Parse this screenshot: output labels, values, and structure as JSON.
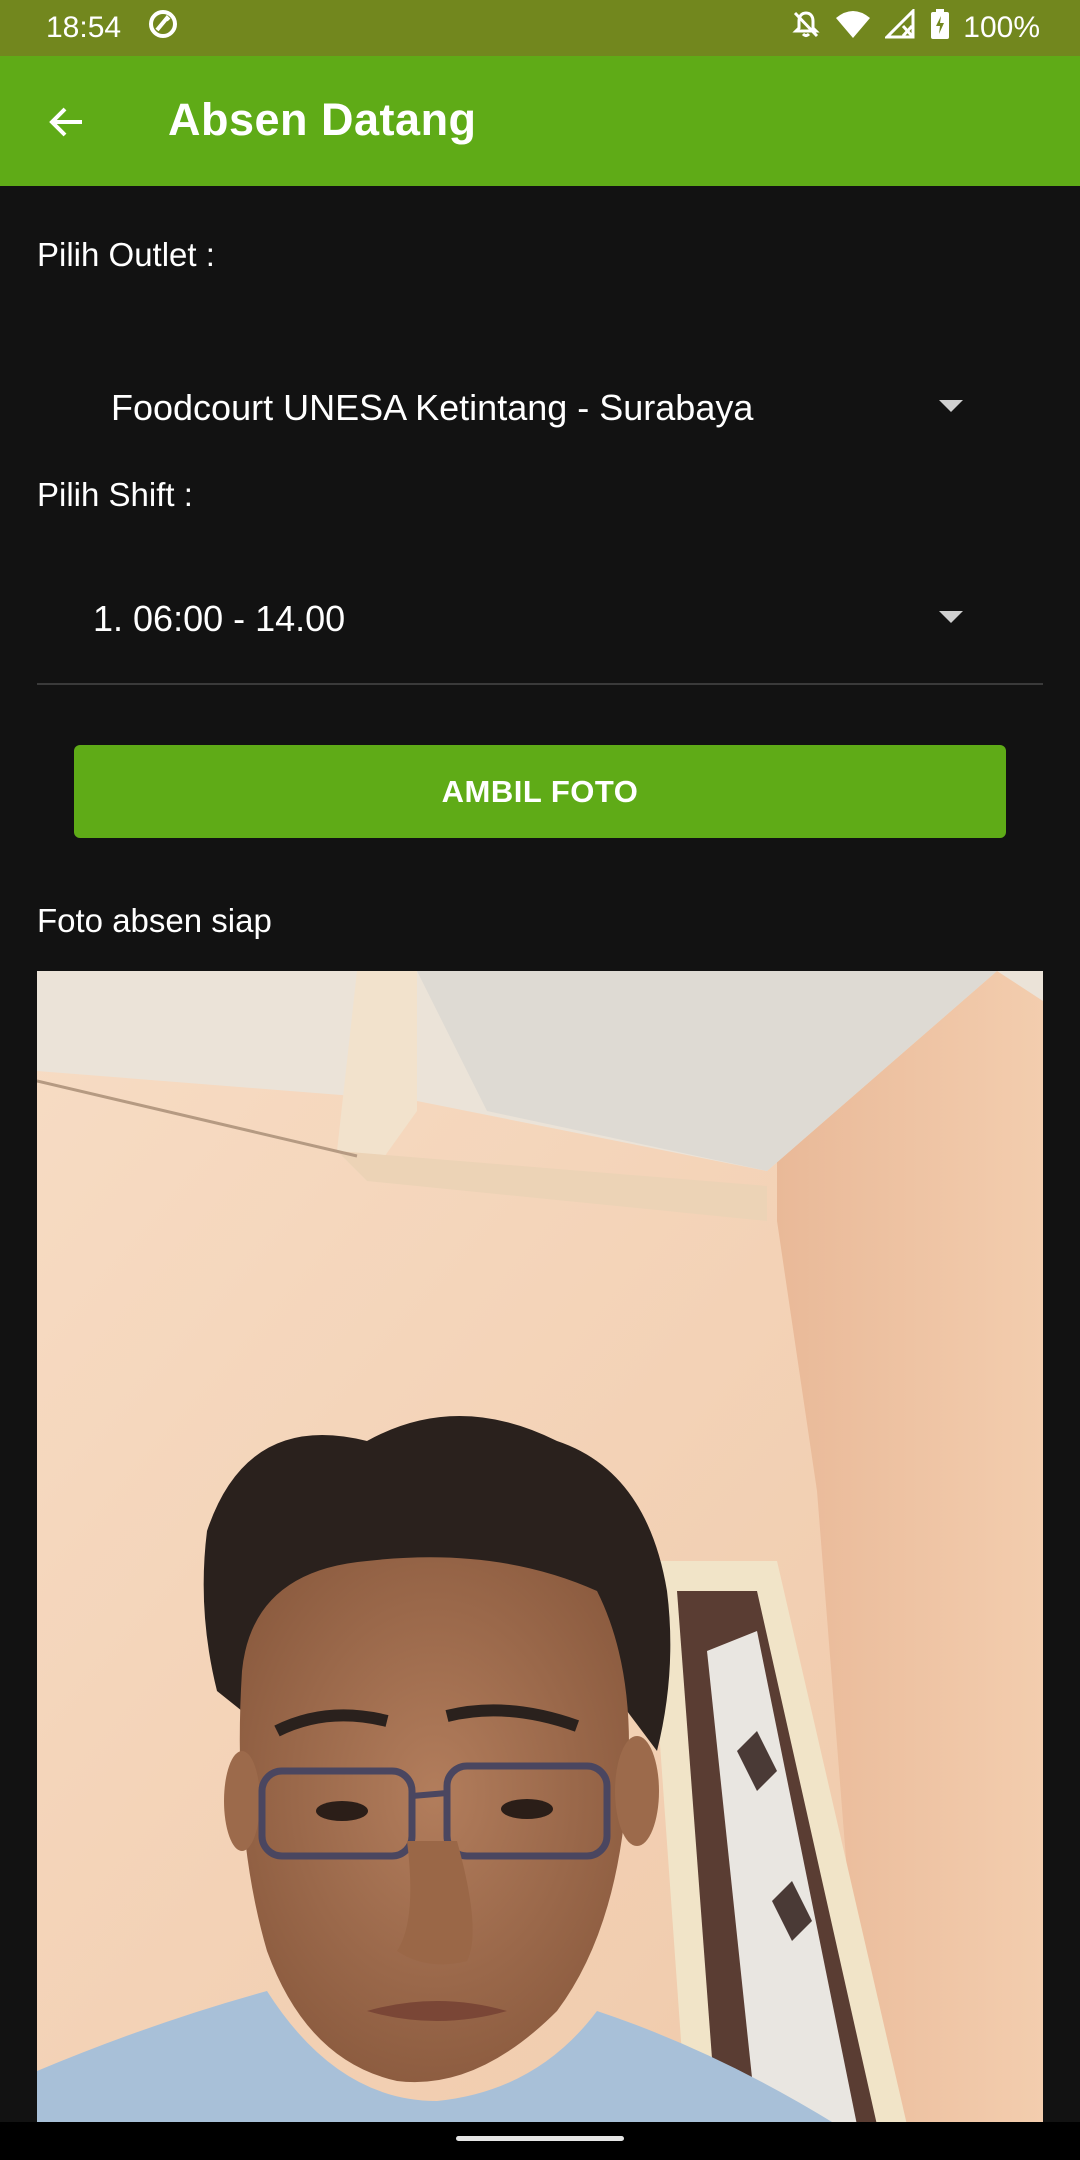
{
  "status_bar": {
    "time": "18:54",
    "battery": "100%"
  },
  "header": {
    "title": "Absen Datang"
  },
  "form": {
    "outlet_label": "Pilih Outlet :",
    "outlet_value": "Foodcourt UNESA Ketintang - Surabaya",
    "shift_label": "Pilih Shift :",
    "shift_value": "1. 06:00 - 14.00",
    "take_photo_button": "AMBIL FOTO",
    "photo_status": "Foto absen siap"
  },
  "colors": {
    "status_bar": "#72871e",
    "app_bar": "#5fab17",
    "button": "#5fab17",
    "background": "#121212"
  }
}
